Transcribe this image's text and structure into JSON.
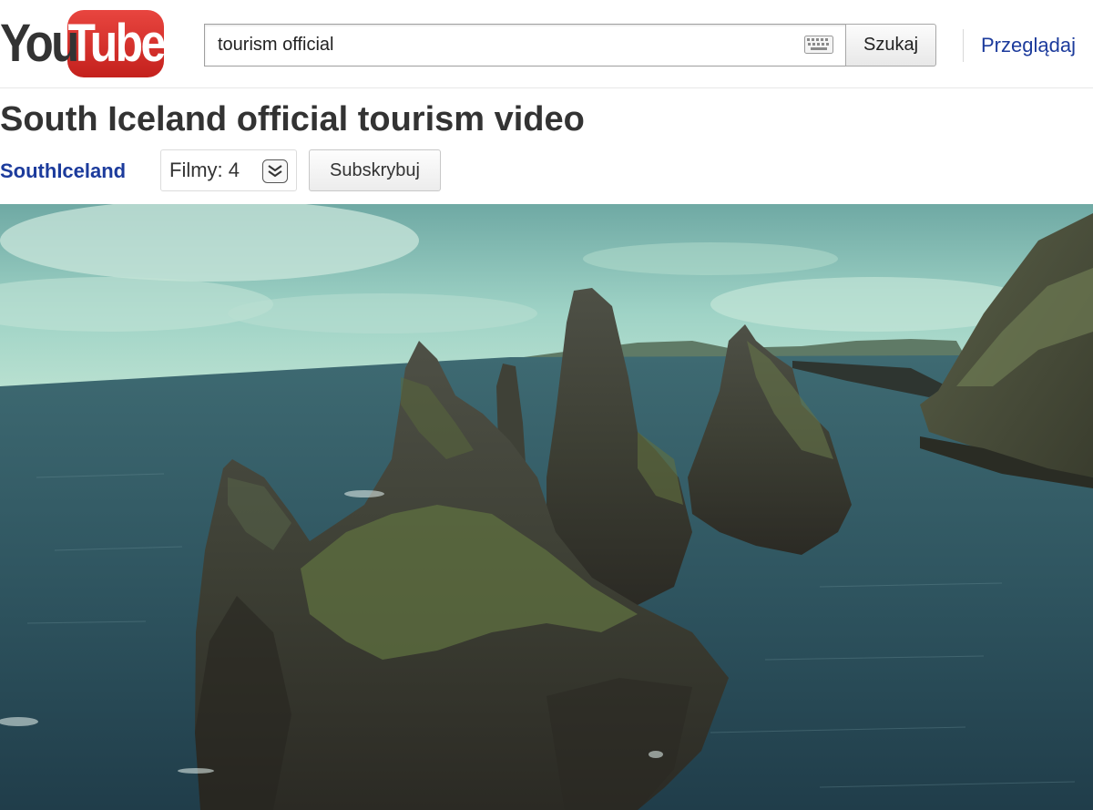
{
  "header": {
    "logo_you": "You",
    "logo_tube": "Tube",
    "search": {
      "value": "tourism official",
      "button_label": "Szukaj"
    },
    "browse_label": "Przeglądaj"
  },
  "video": {
    "title": "South Iceland official tourism video",
    "channel_name": "SouthIceland",
    "videos_count_label": "Filmy: 4",
    "subscribe_label": "Subskrybuj"
  },
  "colors": {
    "logo_red": "#d32f2a",
    "link_blue": "#1c3b9c",
    "title_text": "#333333"
  },
  "icons": {
    "keyboard": "keyboard-icon",
    "expand": "chevron-double-down-icon"
  }
}
